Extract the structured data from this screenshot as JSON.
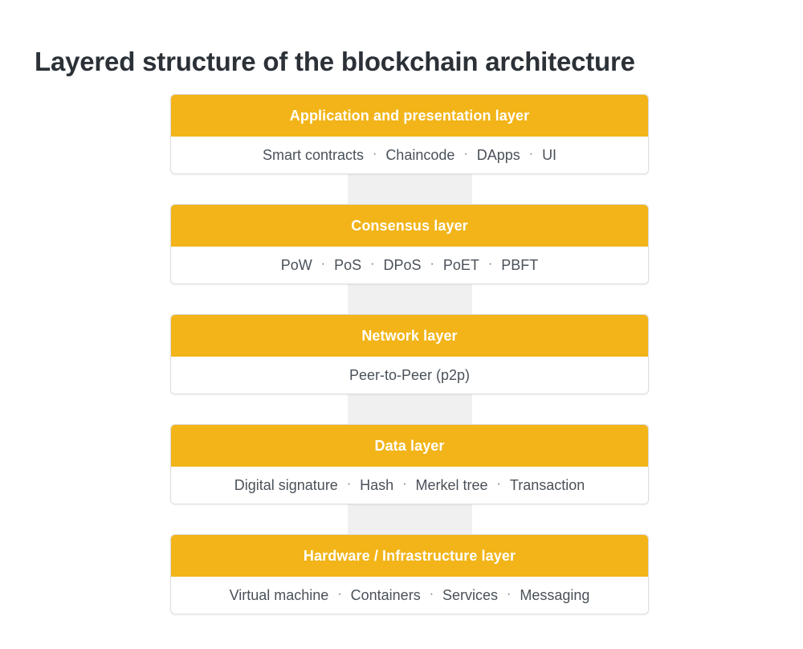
{
  "title": "Layered structure of the blockchain architecture",
  "separator": "·",
  "colors": {
    "header_yellow": "#f2b418",
    "title_text": "#2b3137",
    "body_text": "#4a5159",
    "connector_gray": "#f0f0f1",
    "border_gray": "#dcdcdd",
    "background": "#ffffff"
  },
  "layers": [
    {
      "header": "Application and presentation layer",
      "items": [
        "Smart contracts",
        "Chaincode",
        "DApps",
        "UI"
      ]
    },
    {
      "header": "Consensus layer",
      "items": [
        "PoW",
        "PoS",
        "DPoS",
        "PoET",
        "PBFT"
      ]
    },
    {
      "header": "Network layer",
      "items": [
        "Peer-to-Peer (p2p)"
      ]
    },
    {
      "header": "Data layer",
      "items": [
        "Digital signature",
        "Hash",
        "Merkel tree",
        "Transaction"
      ]
    },
    {
      "header": "Hardware / Infrastructure layer",
      "items": [
        "Virtual machine",
        "Containers",
        "Services",
        "Messaging"
      ]
    }
  ]
}
